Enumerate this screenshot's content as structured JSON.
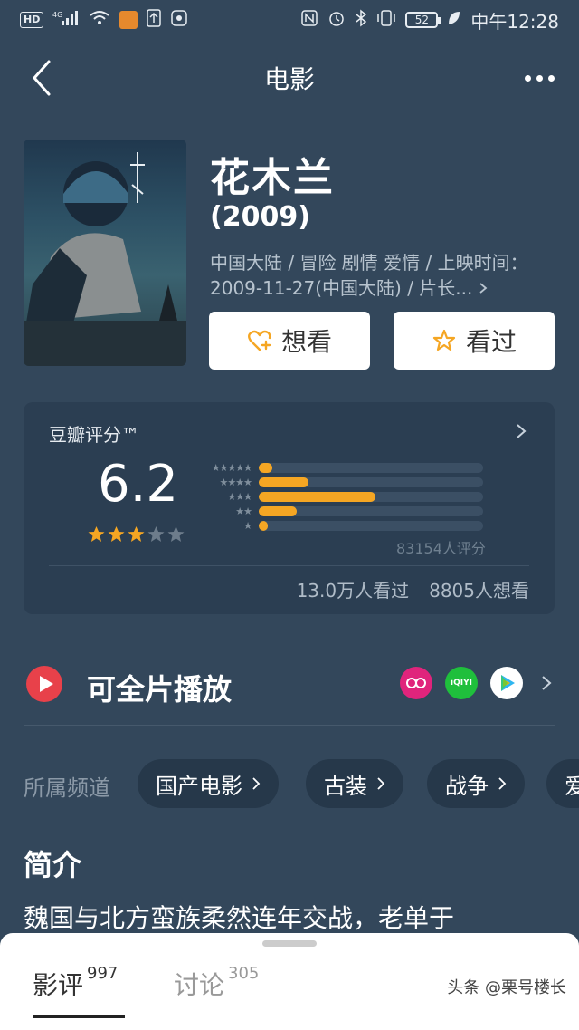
{
  "status_bar": {
    "left_chips": [
      "HD",
      "4G"
    ],
    "battery": "52",
    "time": "中午12:28"
  },
  "nav": {
    "title": "电影"
  },
  "movie": {
    "title": "花木兰",
    "year": "(2009)",
    "meta": "中国大陆 / 冒险 剧情 爱情 / 上映时间：2009-11-27(中国大陆) / 片长...",
    "want_label": "想看",
    "seen_label": "看过"
  },
  "rating": {
    "title": "豆瓣评分™",
    "score": "6.2",
    "stars_filled": 3,
    "stars_total": 5,
    "distribution": [
      {
        "stars": "★★★★★",
        "fraction": 0.06
      },
      {
        "stars": "★★★★",
        "fraction": 0.22
      },
      {
        "stars": "★★★",
        "fraction": 0.52
      },
      {
        "stars": "★★",
        "fraction": 0.17
      },
      {
        "stars": "★",
        "fraction": 0.04
      }
    ],
    "rating_count": "83154人评分",
    "watched": "13.0万人看过",
    "want_to_watch": "8805人想看"
  },
  "play": {
    "label": "可全片播放",
    "platforms": [
      "mgtv",
      "iQIYI",
      "tencent-video"
    ]
  },
  "channels": {
    "label": "所属频道",
    "items": [
      "国产电影",
      "古装",
      "战争",
      "爱"
    ]
  },
  "intro": {
    "title": "简介",
    "text": "魏国与北方蛮族柔然连年交战，老单于"
  },
  "bottom_tabs": {
    "reviews_label": "影评",
    "reviews_count": "997",
    "discuss_label": "讨论",
    "discuss_count": "305"
  },
  "watermark": "头条 @栗号楼长",
  "colors": {
    "background": "#33475b",
    "accent_orange": "#f5a623",
    "play_red": "#e8414a"
  }
}
